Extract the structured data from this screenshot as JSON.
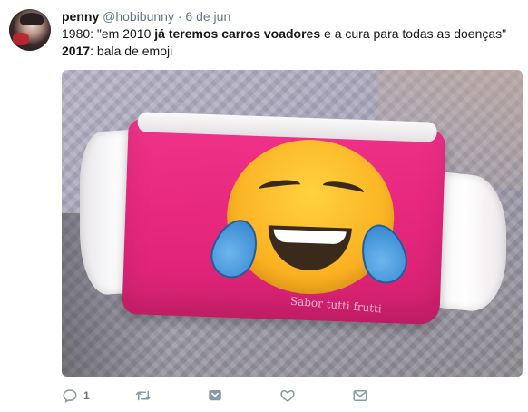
{
  "tweet": {
    "name": "penny",
    "handle": "@hobibunny",
    "separator": "·",
    "time": "6 de jun",
    "line1_prefix": "1980: \"em 2010 ",
    "line1_bold": "já teremos carros voadores",
    "line1_suffix": " e a cura para todas as doenças\"",
    "line2_bold": "2017",
    "line2_suffix": ": bala de emoji"
  },
  "media": {
    "image_text": "Sabor tutti frutti"
  },
  "actions": {
    "reply_count": "1",
    "icons": [
      "reply-icon",
      "retweet-icon",
      "like-icon",
      "message-icon",
      "caret-down-icon"
    ]
  },
  "colors": {
    "text": "#14171a",
    "muted": "#657786",
    "candy_pink": "#e8287f",
    "icon_gray": "#8899a6"
  }
}
